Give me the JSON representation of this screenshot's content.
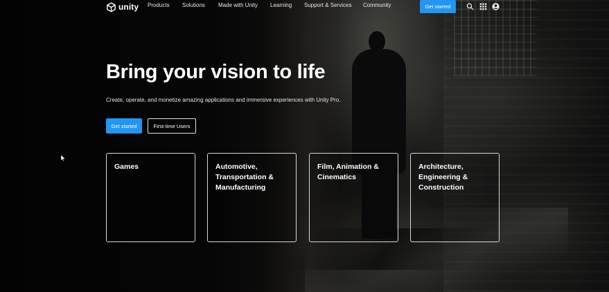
{
  "nav": {
    "logo_text": "unity",
    "links": [
      {
        "label": "Products"
      },
      {
        "label": "Solutions"
      },
      {
        "label": "Made with Unity"
      },
      {
        "label": "Learning"
      },
      {
        "label": "Support & Services"
      },
      {
        "label": "Community"
      }
    ],
    "cta_label": "Get started",
    "icons": [
      "search-icon",
      "apps-grid-icon",
      "account-icon"
    ]
  },
  "hero": {
    "title": "Bring your vision to life",
    "subtitle": "Create, operate, and monetize amazing applications and immersive experiences with Unity Pro.",
    "primary_button": "Get started",
    "secondary_button": "First-time Users"
  },
  "cards": [
    {
      "label": "Games"
    },
    {
      "label": "Automotive, Transportation & Manufacturing"
    },
    {
      "label": "Film, Animation & Cinematics"
    },
    {
      "label": "Architecture, Engineering & Construction"
    }
  ],
  "colors": {
    "accent": "#2196f3",
    "background": "#050505",
    "text": "#ffffff",
    "card_border": "#d8d8d8"
  }
}
